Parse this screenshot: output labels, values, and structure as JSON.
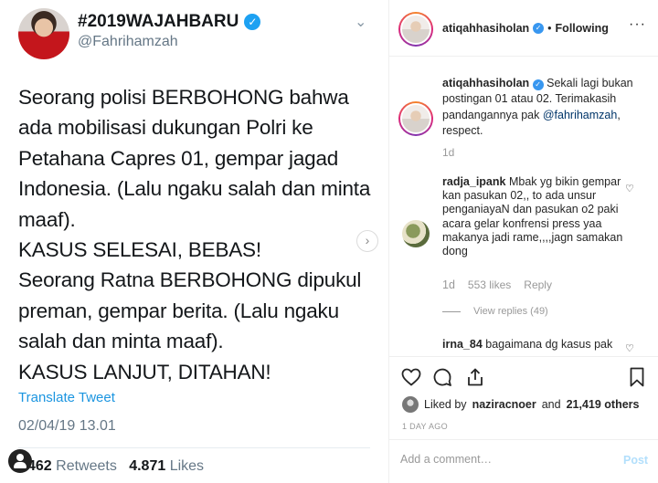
{
  "tweet": {
    "display_name": "#2019WAJAHBARU",
    "handle": "@Fahrihamzah",
    "lines": [
      "Seorang polisi BERBOHONG bahwa",
      "ada mobilisasi dukungan Polri ke",
      "Petahana Capres 01, gempar jagad",
      "Indonesia. (Lalu ngaku salah dan minta",
      "maaf).",
      "KASUS SELESAI, BEBAS!",
      "Seorang Ratna BERBOHONG dipukul",
      "preman, gempar berita. (Lalu ngaku",
      "salah dan minta maaf).",
      "KASUS LANJUT, DITAHAN!"
    ],
    "translate": "Translate Tweet",
    "date": "02/04/19 13.01",
    "retweets_count": "462",
    "retweets_label": "Retweets",
    "likes_count": "4.871",
    "likes_label": "Likes"
  },
  "header": {
    "username": "atiqahhasiholan",
    "dot": "•",
    "following": "Following"
  },
  "caption": {
    "username": "atiqahhasiholan",
    "text": "Sekali lagi bukan postingan 01 atau 02. Terimakasih pandangannya pak",
    "mention": "@fahrihamzah",
    "tail": ", respect.",
    "time": "1d"
  },
  "comments": [
    {
      "username": "radja_ipank",
      "text": "Mbak yg bikin gempar kan pasukan 02,, to ada unsur penganiayaN dan pasukan o2 paki acara gelar konfrensi press yaa makanya jadi rame,,,,jagn samakan dong",
      "time": "1d",
      "likes": "553 likes",
      "reply": "Reply",
      "view_replies": "View replies (49)"
    },
    {
      "username": "irna_84",
      "text": "bagaimana dg kasus pak"
    }
  ],
  "likes": {
    "prefix": "Liked by",
    "user": "naziracnoer",
    "middle": "and",
    "others": "21,419 others"
  },
  "time_ago": "1 DAY AGO",
  "add_comment": {
    "placeholder": "Add a comment…",
    "post": "Post"
  }
}
